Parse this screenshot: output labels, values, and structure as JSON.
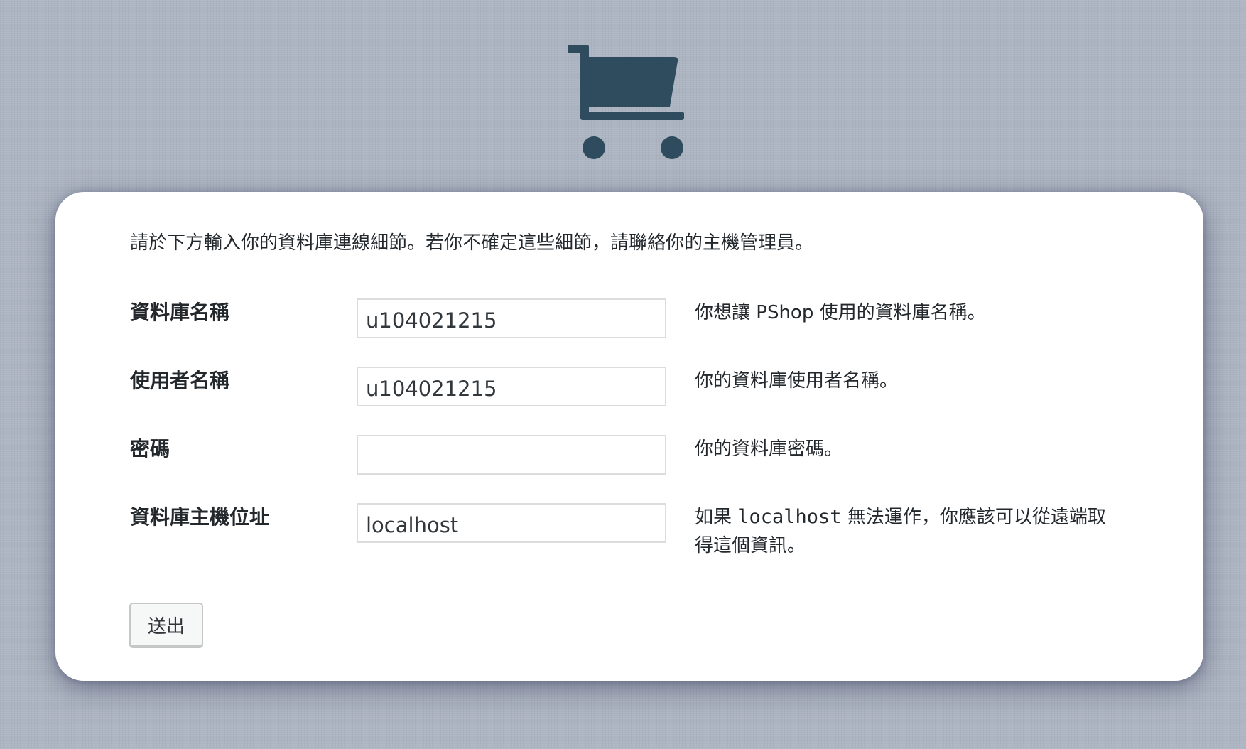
{
  "logo": {
    "icon": "shopping-cart-icon",
    "color": "#2f4b5e"
  },
  "intro_text": "請於下方輸入你的資料庫連線細節。若你不確定這些細節，請聯絡你的主機管理員。",
  "fields": [
    {
      "label": "資料庫名稱",
      "value": "u104021215",
      "desc": "你想讓 PShop 使用的資料庫名稱。"
    },
    {
      "label": "使用者名稱",
      "value": "u104021215",
      "desc": "你的資料庫使用者名稱。"
    },
    {
      "label": "密碼",
      "value": "",
      "desc": "你的資料庫密碼。"
    },
    {
      "label": "資料庫主機位址",
      "value": "localhost",
      "desc_prefix": "如果 ",
      "desc_code": "localhost",
      "desc_suffix": " 無法運作，你應該可以從遠端取得這個資訊。"
    }
  ],
  "submit_label": "送出"
}
